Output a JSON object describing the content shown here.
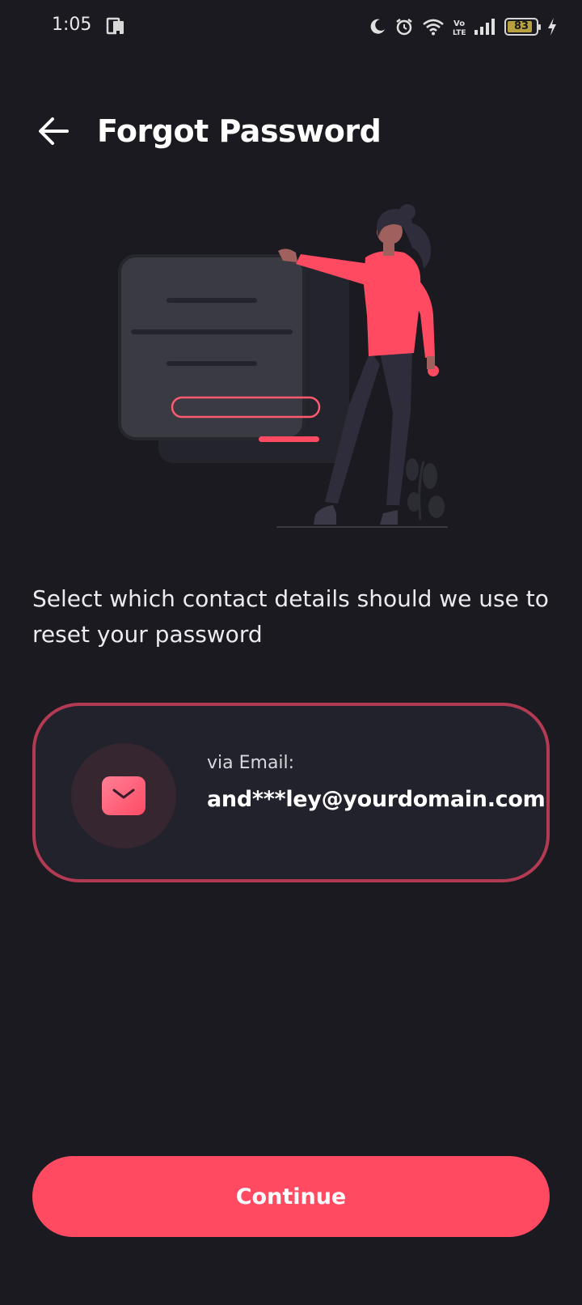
{
  "status_bar": {
    "time": "1:05",
    "battery_level": "83",
    "icons": [
      "notification-icon",
      "moon-icon",
      "alarm-icon",
      "wifi-icon",
      "volte-icon",
      "signal-icon",
      "battery-icon",
      "charging-icon"
    ]
  },
  "header": {
    "back_icon": "arrow-left-icon",
    "title": "Forgot Password"
  },
  "illustration": {
    "name": "forgot-password-illustration"
  },
  "prompt": {
    "text": "Select which contact details should we use to reset your password"
  },
  "contact_option": {
    "icon": "mail-icon",
    "label": "via Email:",
    "value": "and***ley@yourdomain.com",
    "selected": true
  },
  "actions": {
    "continue_label": "Continue"
  },
  "colors": {
    "background": "#1a1a20",
    "accent": "#ff4a62",
    "card_border": "#b23a52",
    "card_background": "#22222c"
  }
}
